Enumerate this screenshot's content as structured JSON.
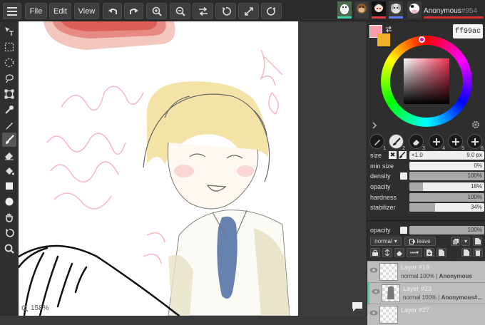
{
  "topbar": {
    "file_label": "File",
    "edit_label": "Edit",
    "view_label": "View",
    "user_name": "Anonymous",
    "user_id": "#954"
  },
  "canvas": {
    "zoom": "158%"
  },
  "color": {
    "hex": "ff99ac",
    "primary": "#ff99ac",
    "secondary": "#f0b028"
  },
  "brush_slots": [
    "1",
    "2",
    "3",
    "4",
    "5",
    "6"
  ],
  "brush": {
    "size_label": "size",
    "size_mult": "×1.0",
    "size_value": "9.0 px",
    "min_size_label": "min size",
    "min_size_value": "0%",
    "min_size_level": 0,
    "density_label": "density",
    "density_value": "100%",
    "density_level": 100,
    "opacity_label": "opacity",
    "opacity_value": "18%",
    "opacity_level": 18,
    "hardness_label": "hardness",
    "hardness_value": "100%",
    "hardness_level": 100,
    "stabilizer_label": "stabilizer",
    "stabilizer_value": "34%",
    "stabilizer_level": 34
  },
  "layer_panel": {
    "opacity_label": "opacity",
    "opacity_value": "100%",
    "opacity_level": 100,
    "blend_mode": "normal",
    "leave_label": "leave"
  },
  "layers": [
    {
      "name": "Layer #18",
      "meta": "normal 100%  |  ",
      "owner": "Anonymous"
    },
    {
      "name": "Layer #23",
      "meta": "normal 100%  |  ",
      "owner": "Anonymous#..."
    },
    {
      "name": "Layer #27",
      "meta": "",
      "owner": ""
    }
  ]
}
